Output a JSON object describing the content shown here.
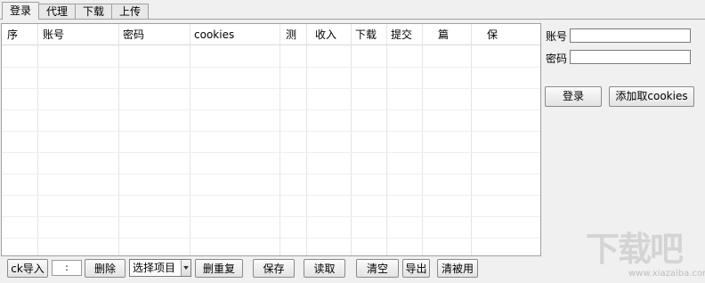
{
  "tabs": [
    "登录",
    "代理",
    "下载",
    "上传"
  ],
  "active_tab": 0,
  "grid": {
    "columns": [
      "序",
      "账号",
      "密码",
      "cookies",
      "测",
      "收入",
      "下载",
      "提交",
      "篇",
      "保"
    ],
    "rows": []
  },
  "login_panel": {
    "account_label": "账号",
    "account_value": "",
    "password_label": "密码",
    "password_value": "",
    "login_button": "登录",
    "add_cookies_button": "添加取cookies"
  },
  "toolbar": {
    "ck_import": "ck导入",
    "separator_value": ":",
    "delete": "删除",
    "select_item": "选择项目",
    "dedupe": "删重复",
    "save": "保存",
    "read": "读取",
    "clear": "清空",
    "export": "导出",
    "clear_banned": "清被用"
  },
  "watermark": {
    "text": "下载吧",
    "url": "www.xiazaiba.com"
  }
}
